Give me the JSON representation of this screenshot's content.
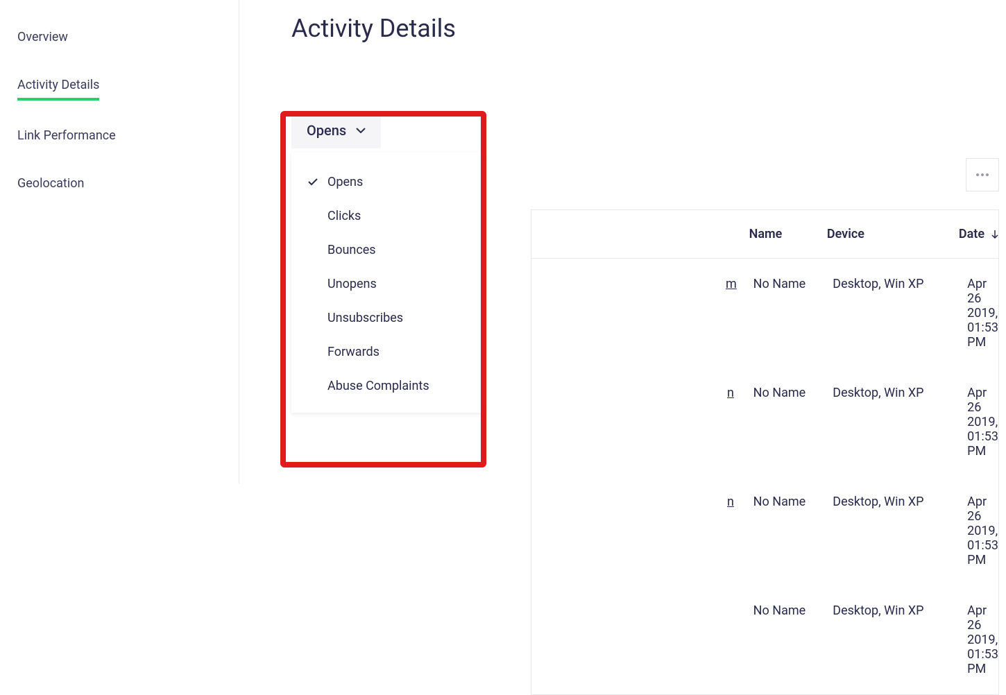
{
  "sidebar": {
    "items": [
      {
        "label": "Overview",
        "active": false
      },
      {
        "label": "Activity Details",
        "active": true
      },
      {
        "label": "Link Performance",
        "active": false
      },
      {
        "label": "Geolocation",
        "active": false
      }
    ]
  },
  "page": {
    "title": "Activity Details"
  },
  "dropdown": {
    "selected": "Opens",
    "options": [
      {
        "label": "Opens",
        "checked": true
      },
      {
        "label": "Clicks",
        "checked": false
      },
      {
        "label": "Bounces",
        "checked": false
      },
      {
        "label": "Unopens",
        "checked": false
      },
      {
        "label": "Unsubscribes",
        "checked": false
      },
      {
        "label": "Forwards",
        "checked": false
      },
      {
        "label": "Abuse Complaints",
        "checked": false
      }
    ]
  },
  "table": {
    "headers": {
      "email": "",
      "name": "Name",
      "device": "Device",
      "date": "Date"
    },
    "rows": [
      {
        "email_suffix": "m",
        "name": "No Name",
        "device": "Desktop, Win XP",
        "date": "Apr 26 2019, 01:53 PM"
      },
      {
        "email_suffix": "n",
        "name": "No Name",
        "device": "Desktop, Win XP",
        "date": "Apr 26 2019, 01:53 PM"
      },
      {
        "email_suffix": "n",
        "name": "No Name",
        "device": "Desktop, Win XP",
        "date": "Apr 26 2019, 01:53 PM"
      },
      {
        "email_suffix": "",
        "name": "No Name",
        "device": "Desktop, Win XP",
        "date": "Apr 26 2019, 01:53 PM"
      }
    ]
  }
}
